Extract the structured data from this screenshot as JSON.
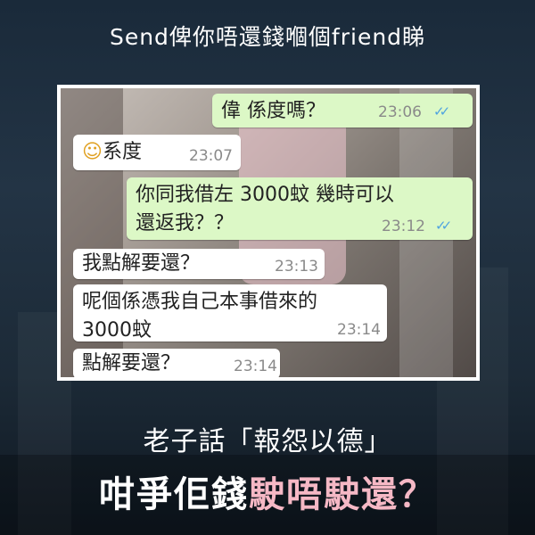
{
  "header": {
    "title": "Send俾你唔還錢嗰個friend睇"
  },
  "chat": {
    "messages": [
      {
        "dir": "out",
        "text": "偉 係度嗎？",
        "time": "23:06"
      },
      {
        "dir": "in",
        "emoji": "☺",
        "text": "系度",
        "time": "23:07"
      },
      {
        "dir": "out",
        "text": "你同我借左 3000蚊  幾時可以\n還返我？？",
        "time": "23:12"
      },
      {
        "dir": "in",
        "text": "我點解要還？",
        "time": "23:13"
      },
      {
        "dir": "in",
        "text": "呢個係憑我自己本事借來的\n3000蚊",
        "time": "23:14"
      },
      {
        "dir": "in",
        "text": "點解要還？",
        "time": "23:14"
      }
    ],
    "read_tick": "✓✓"
  },
  "caption": {
    "line1": "老子話「報怨以德」",
    "line2_white": "咁爭佢錢",
    "line2_pink": "駛唔駛還？",
    "pink_color": "#f5b8c5"
  }
}
